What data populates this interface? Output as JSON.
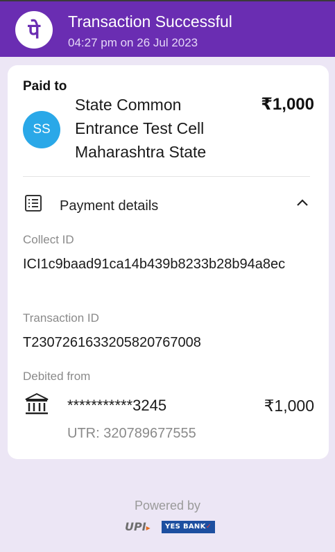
{
  "header": {
    "logo_glyph": "पे",
    "title": "Transaction Successful",
    "timestamp": "04:27 pm on 26 Jul 2023",
    "background_color": "#6a2db2"
  },
  "payee": {
    "section_label": "Paid to",
    "initials": "SS",
    "name_lines": [
      "State Common",
      "Entrance Test Cell",
      "Maharashtra State"
    ],
    "amount": "₹1,000",
    "avatar_color": "#2aa8e8"
  },
  "payment_details": {
    "label": "Payment details",
    "icon": "receipt-list-icon",
    "toggle_icon": "chevron-up-icon",
    "collect_id_label": "Collect ID",
    "collect_id": "ICI1c9baad91ca14b439b8233b28b94a8ec",
    "transaction_id_label": "Transaction ID",
    "transaction_id": "T2307261633205820767008",
    "debited_from_label": "Debited from",
    "bank_icon": "bank-icon",
    "account": "***********3245",
    "debit_amount": "₹1,000",
    "utr": "UTR: 320789677555"
  },
  "footer": {
    "powered_by": "Powered by",
    "upi_text": "UPI",
    "bank_text": "YES BANK"
  }
}
